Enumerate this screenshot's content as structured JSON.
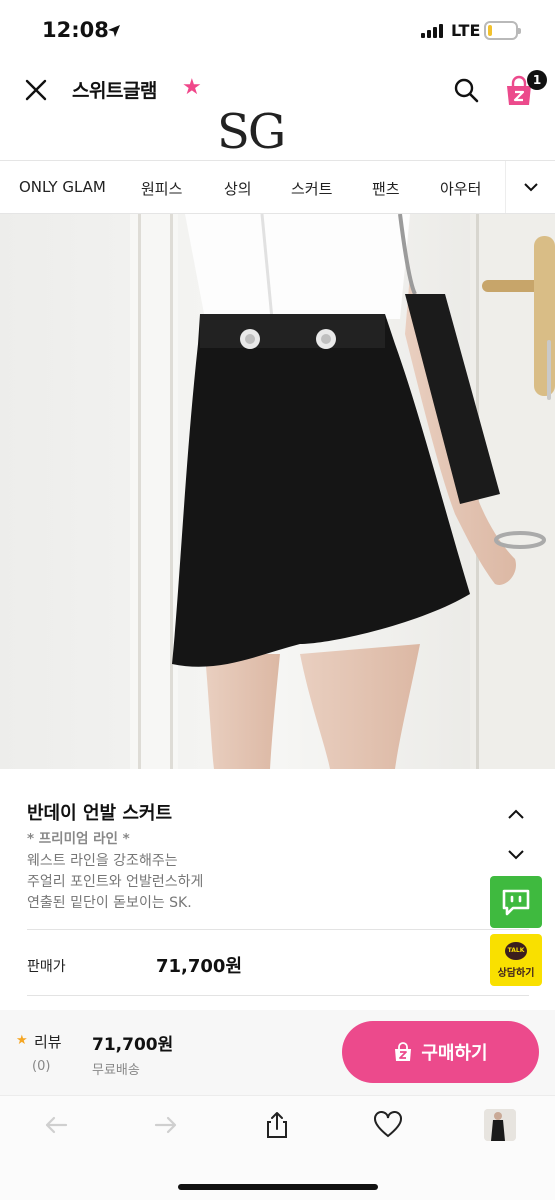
{
  "status": {
    "time": "12:08",
    "network": "LTE",
    "battery_level": 0.15
  },
  "header": {
    "store_name": "스위트글램",
    "favorite_icon": "star-icon",
    "cart_count": "1",
    "brand_logo": "SG"
  },
  "categories": [
    "ONLY GLAM",
    "원피스",
    "상의",
    "스커트",
    "팬츠",
    "아우터"
  ],
  "product": {
    "title": "반데이 언발 스커트",
    "line": "* 프리미엄 라인 *",
    "description": [
      "웨스트 라인을 강조해주는",
      "주얼리 포인트와 언발런스하게",
      "연출된 밑단이 돋보이는 SK."
    ],
    "price_label": "판매가",
    "price": "71,700원"
  },
  "side_buttons": {
    "kakao_label": "상담하기",
    "kakao_bubble": "TALK"
  },
  "purchase": {
    "review_label": "리뷰",
    "review_count": "(0)",
    "price": "71,700원",
    "shipping": "무료배송",
    "buy_label": "구매하기"
  },
  "colors": {
    "accent_pink": "#ec4a8c",
    "kakao_yellow": "#f9e000",
    "talk_green": "#3fba3f"
  }
}
